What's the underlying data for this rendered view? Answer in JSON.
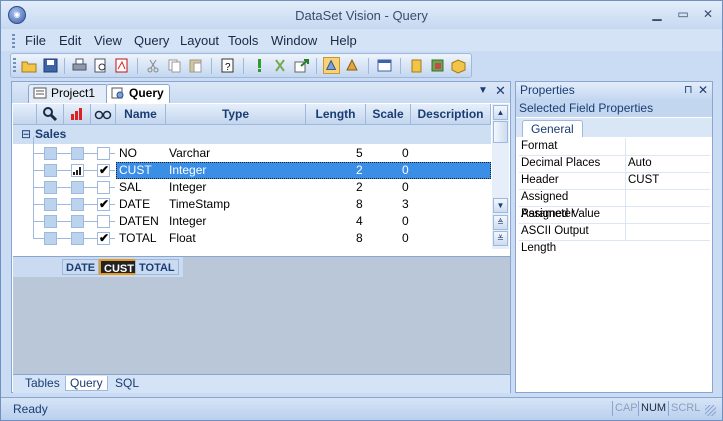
{
  "window": {
    "title": "DataSet Vision - Query"
  },
  "menu": [
    "File",
    "Edit",
    "View",
    "Query",
    "Layout",
    "Tools",
    "Window",
    "Help"
  ],
  "doc_tabs": [
    {
      "label": "Project1",
      "active": false
    },
    {
      "label": "Query",
      "active": true
    }
  ],
  "grid": {
    "columns": {
      "name": "Name",
      "type": "Type",
      "length": "Length",
      "scale": "Scale",
      "description": "Description"
    },
    "group": "Sales",
    "group_toggle": "⊟",
    "rows": [
      {
        "name": "NO",
        "type": "Varchar",
        "length": "5",
        "scale": "0",
        "output": false,
        "bars": false
      },
      {
        "name": "CUST",
        "type": "Integer",
        "length": "2",
        "scale": "0",
        "output": true,
        "bars": true
      },
      {
        "name": "SAL",
        "type": "Integer",
        "length": "2",
        "scale": "0",
        "output": false,
        "bars": false
      },
      {
        "name": "DATE",
        "type": "TimeStamp",
        "length": "8",
        "scale": "3",
        "output": true,
        "bars": false
      },
      {
        "name": "DATEN",
        "type": "Integer",
        "length": "4",
        "scale": "0",
        "output": false,
        "bars": false
      },
      {
        "name": "TOTAL",
        "type": "Float",
        "length": "8",
        "scale": "0",
        "output": true,
        "bars": false
      }
    ],
    "selected_row": 1
  },
  "query_fields": [
    "DATE",
    "CUST",
    "TOTAL"
  ],
  "query_selected": "CUST",
  "bottom_tabs": [
    "Tables",
    "Query",
    "SQL"
  ],
  "properties": {
    "title": "Properties",
    "subtitle": "Selected Field Properties",
    "tab": "General",
    "items": [
      {
        "name": "Format",
        "value": ""
      },
      {
        "name": "Decimal Places",
        "value": "Auto"
      },
      {
        "name": "Header",
        "value": "CUST"
      },
      {
        "name": "Assigned Parameter",
        "value": ""
      },
      {
        "name": "Assigned Value",
        "value": ""
      },
      {
        "name": "ASCII Output Length",
        "value": ""
      }
    ]
  },
  "status": {
    "text": "Ready",
    "indicators": [
      {
        "label": "CAP",
        "active": false
      },
      {
        "label": "NUM",
        "active": true
      },
      {
        "label": "SCRL",
        "active": false
      }
    ]
  },
  "colors": {
    "selection": "#3a8ee6",
    "query_highlight": "#e69a1a",
    "title_text": "#3b4c6b"
  }
}
